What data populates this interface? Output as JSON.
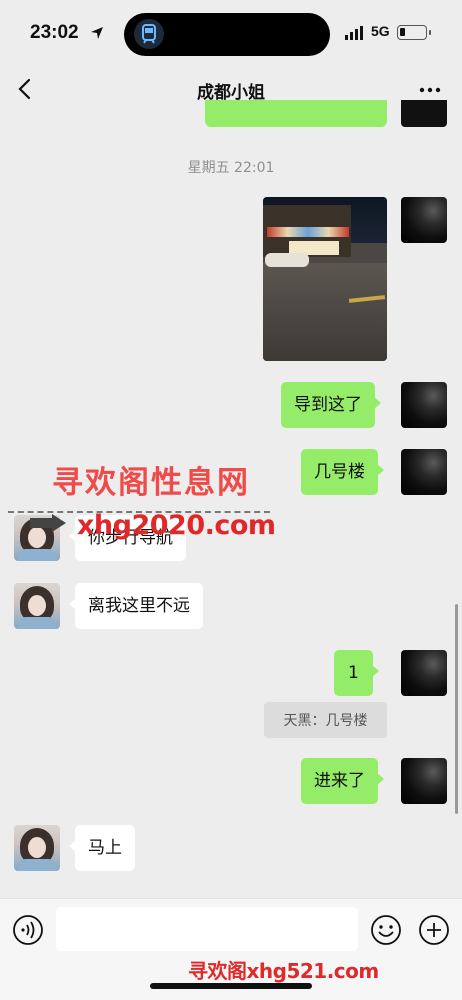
{
  "status_bar": {
    "time": "23:02",
    "network": "5G"
  },
  "header": {
    "title": "成都小姐"
  },
  "timestamp": "星期五 22:01",
  "messages": [
    {
      "side": "right",
      "type": "image"
    },
    {
      "side": "right",
      "text": "导到这了"
    },
    {
      "side": "right",
      "text": "几号楼"
    },
    {
      "side": "left",
      "text": "你步行导航"
    },
    {
      "side": "left",
      "text": "离我这里不远"
    },
    {
      "side": "right",
      "text": "1"
    },
    {
      "side": "right",
      "type": "quote",
      "text": "天黑：几号楼"
    },
    {
      "side": "right",
      "text": "进来了"
    },
    {
      "side": "left",
      "text": "马上"
    }
  ],
  "watermark": {
    "line1": "寻欢阁性息网",
    "line2": "xhg2020.com",
    "bottom": "寻欢阁xhg521.com"
  },
  "input": {
    "placeholder": ""
  },
  "colors": {
    "bubble_green": "#95ec69",
    "background": "#ededed",
    "watermark_red": "#e0282b"
  }
}
